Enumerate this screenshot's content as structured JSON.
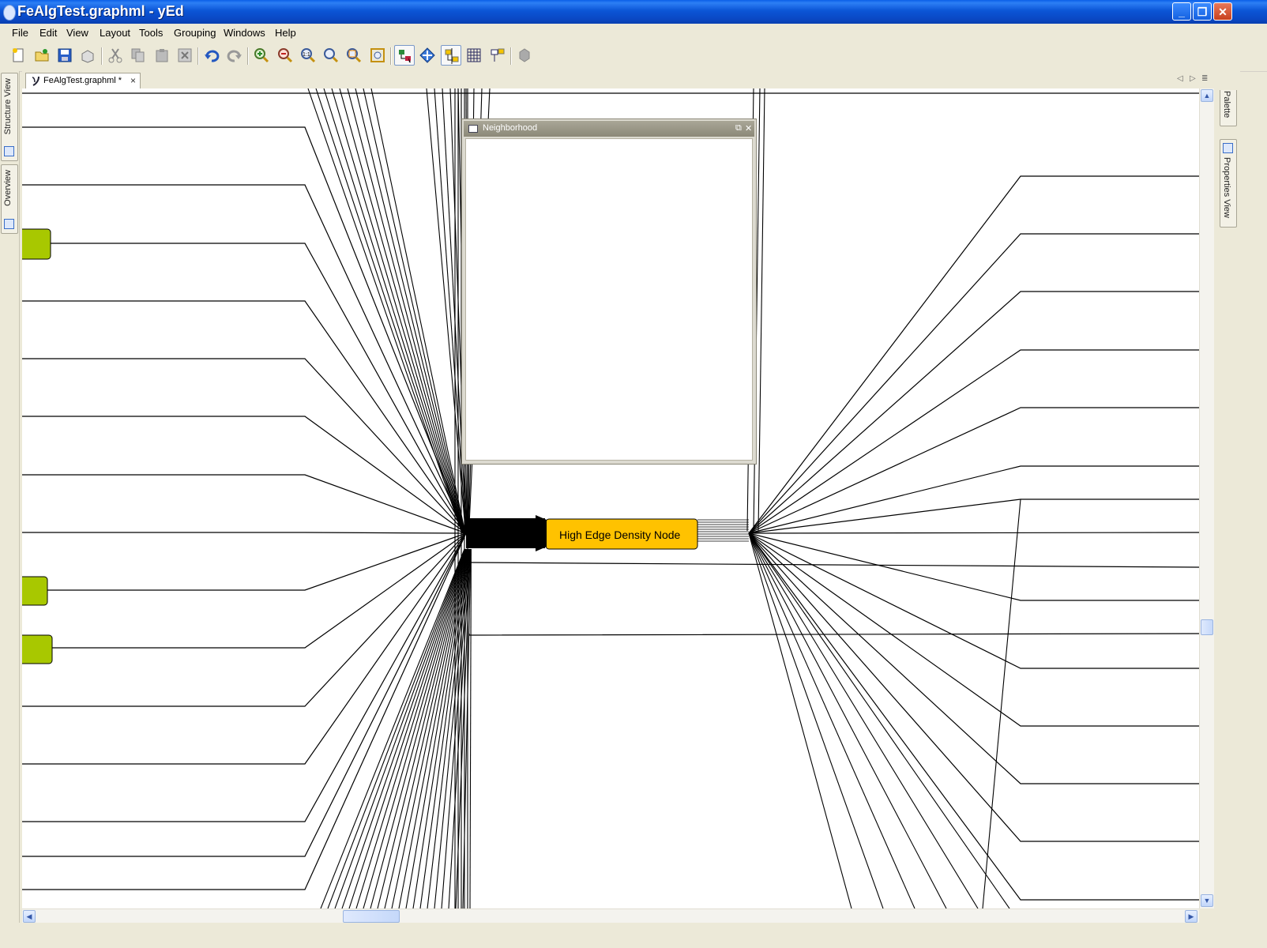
{
  "window": {
    "title": "FeAlgTest.graphml - yEd",
    "minimize": "_",
    "restore": "❐",
    "close": "✕"
  },
  "menubar": {
    "items": [
      {
        "label": "File"
      },
      {
        "label": "Edit"
      },
      {
        "label": "View"
      },
      {
        "label": "Layout"
      },
      {
        "label": "Tools"
      },
      {
        "label": "Grouping"
      },
      {
        "label": "Windows"
      },
      {
        "label": "Help"
      }
    ]
  },
  "toolbar": {
    "buttons": [
      "new-document-icon",
      "open-folder-icon",
      "save-icon",
      "print-icon",
      "cut-icon",
      "copy-icon",
      "paste-icon",
      "delete-icon",
      "undo-icon",
      "redo-icon",
      "zoom-in-icon",
      "zoom-out-icon",
      "zoom-original-icon",
      "zoom-fit-icon",
      "zoom-area-icon",
      "fit-content-icon",
      "edit-mode-icon",
      "navigation-mode-icon",
      "snapping-icon",
      "grid-icon",
      "port-icon",
      "group-icon"
    ]
  },
  "document_tab": {
    "label": "FeAlgTest.graphml *",
    "close": "×"
  },
  "left_panels": [
    {
      "label": "Structure View"
    },
    {
      "label": "Overview"
    }
  ],
  "right_panels": [
    {
      "label": "Palette"
    },
    {
      "label": "Properties View"
    }
  ],
  "neighborhood": {
    "title": "Neighborhood"
  },
  "graph": {
    "central_node_label": "High Edge Density Node",
    "central_node_color": "#ffc200",
    "side_node_color": "#a8c800"
  },
  "colors": {
    "titlebar": "#0a55d6",
    "chrome": "#ece9d8"
  }
}
